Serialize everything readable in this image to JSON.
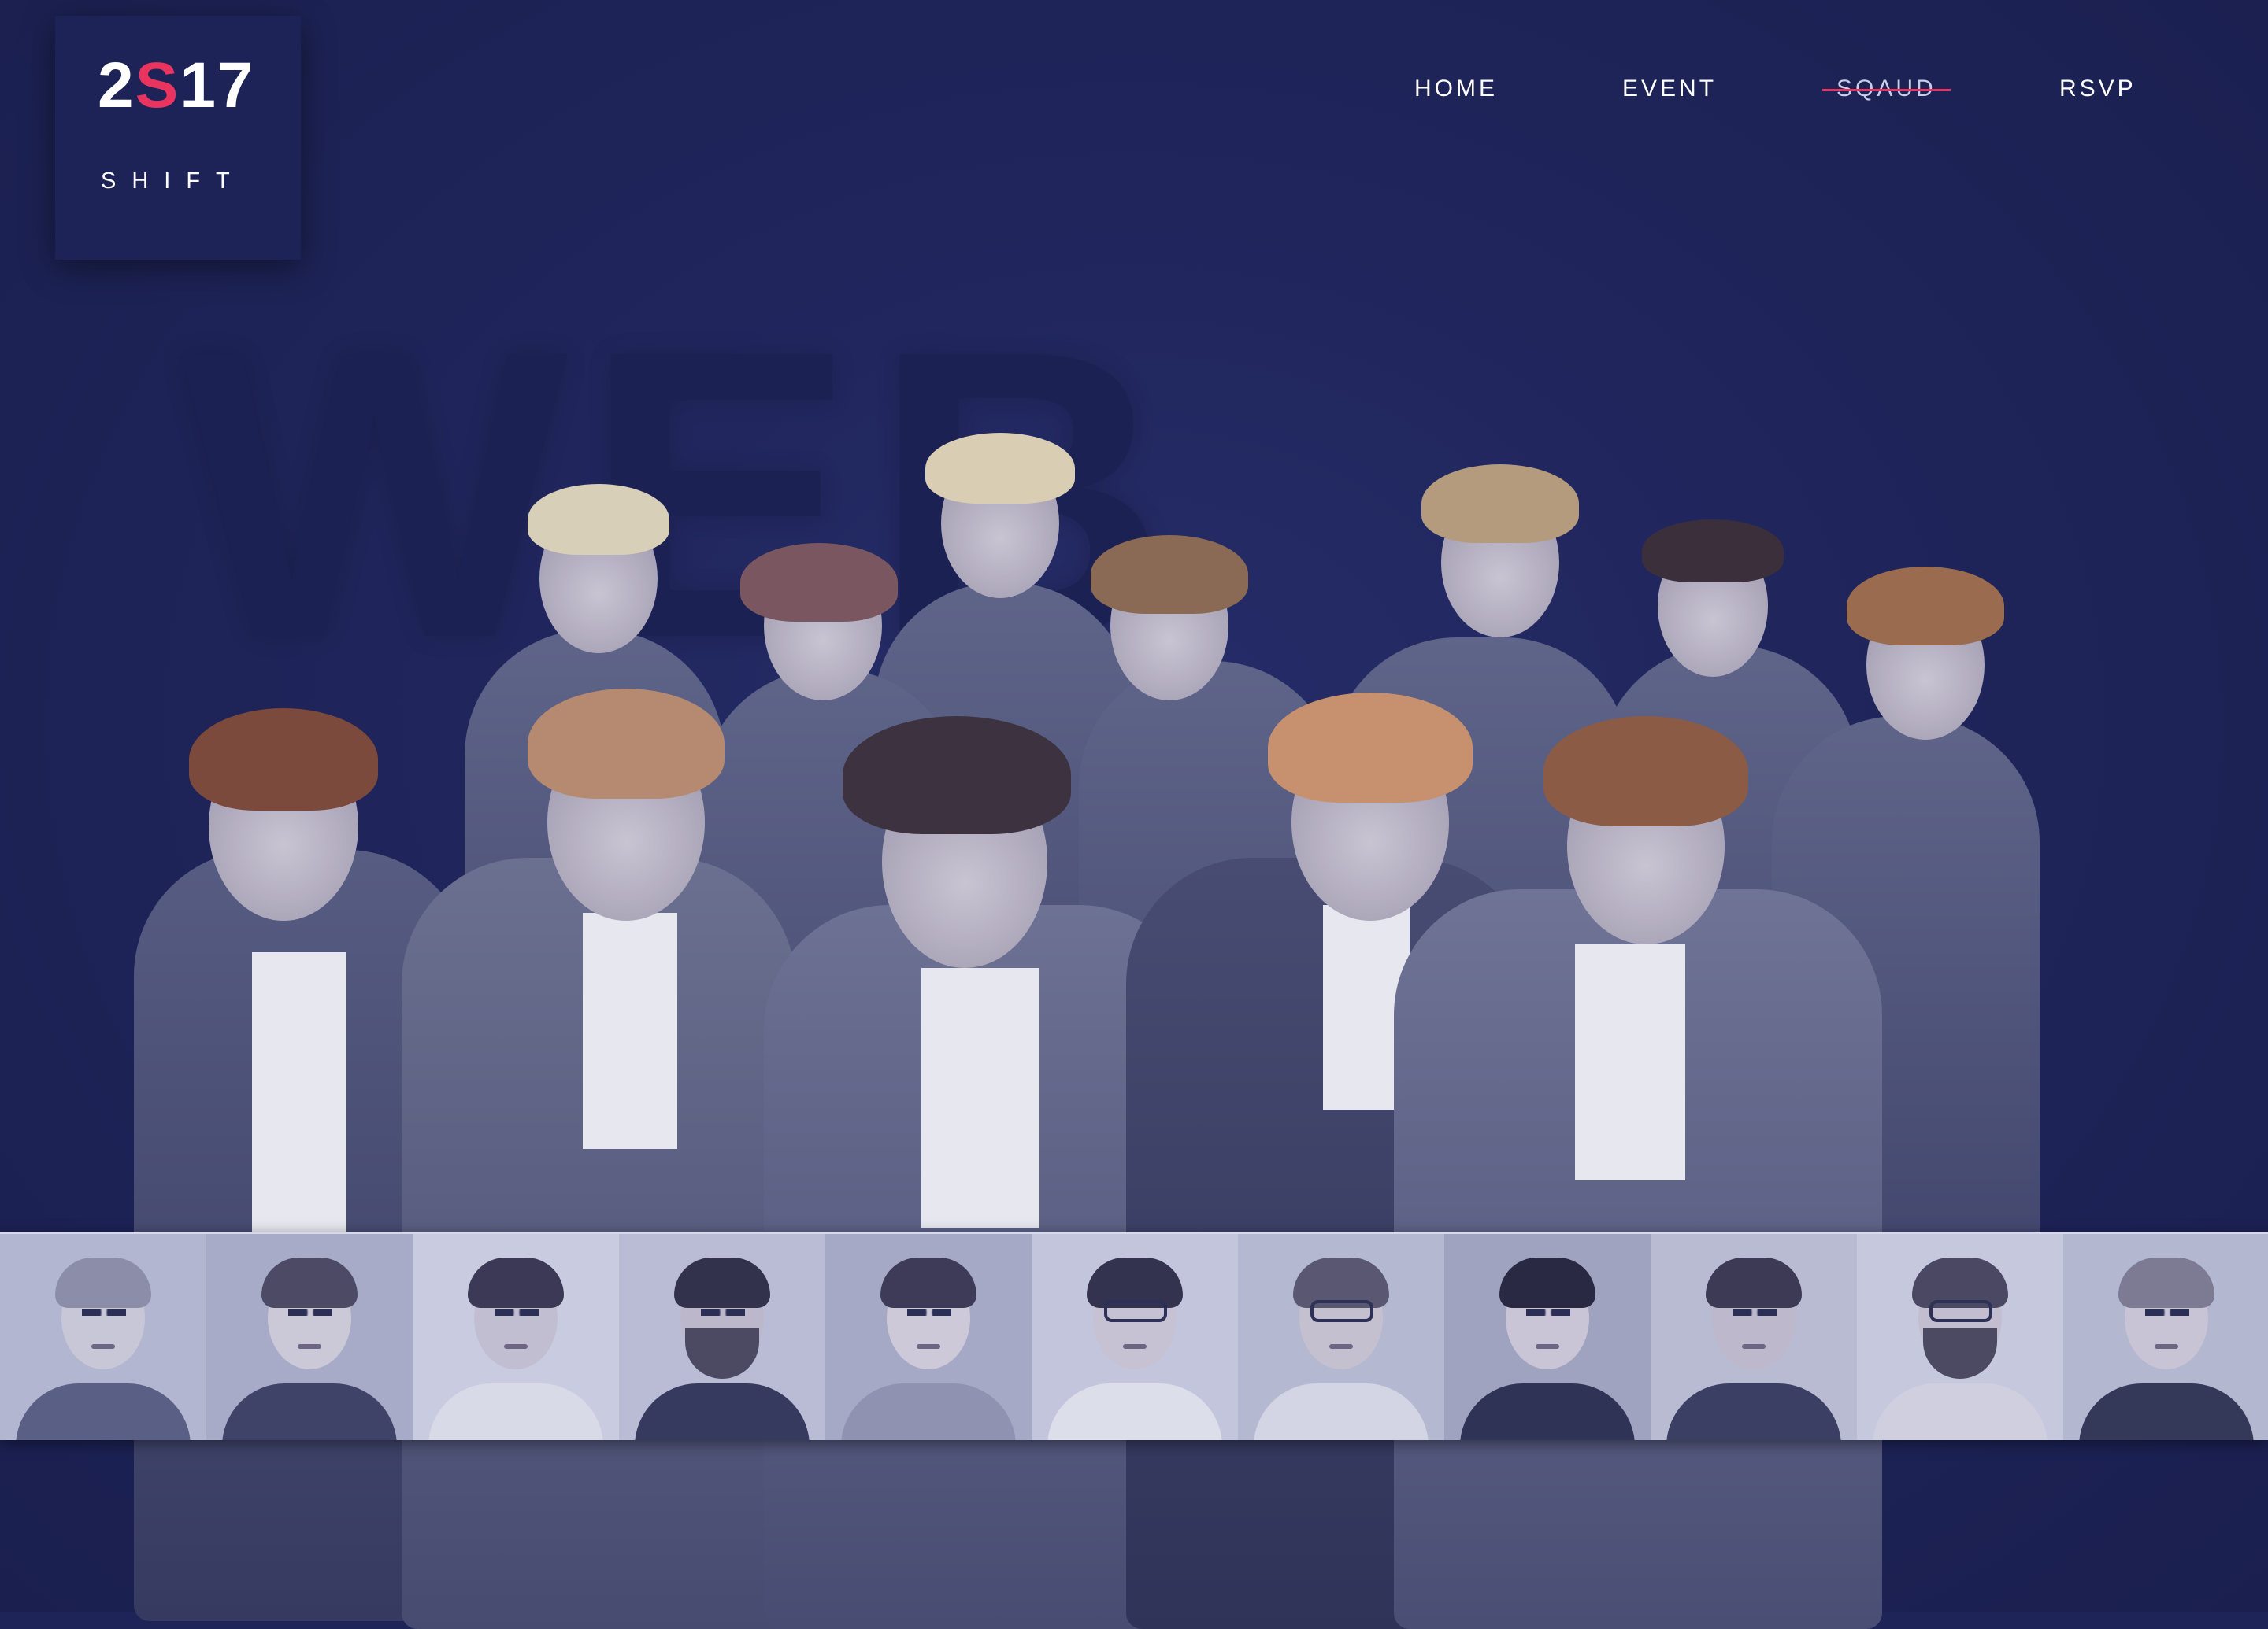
{
  "brand": {
    "year_prefix": "2",
    "year_mark": "S",
    "year_suffix": "17",
    "subtitle": "SHIFT"
  },
  "nav": {
    "items": [
      {
        "label": "HOME",
        "active": false
      },
      {
        "label": "EVENT",
        "active": false
      },
      {
        "label": "SQAUD",
        "active": true
      },
      {
        "label": "RSVP",
        "active": false
      }
    ]
  },
  "hero": {
    "background_word": "WEB"
  },
  "colors": {
    "background": "#1e2458",
    "accent": "#e8345f",
    "nav_text": "#ffffff",
    "strip": "#c8cbe0"
  },
  "squad_strip": {
    "tile_count": 11
  }
}
